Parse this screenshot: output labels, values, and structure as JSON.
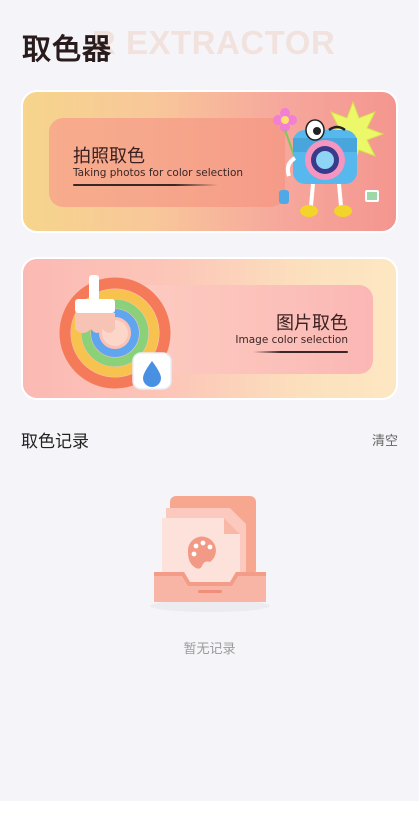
{
  "header": {
    "title": "取色器",
    "background_text": "R EXTRACTOR"
  },
  "cards": [
    {
      "title": "拍照取色",
      "subtitle": "Taking photos for color selection",
      "icon": "camera-character-icon"
    },
    {
      "title": "图片取色",
      "subtitle": "Image color selection",
      "icon": "rainbow-brush-icon"
    }
  ],
  "history": {
    "title": "取色记录",
    "clear_label": "清空",
    "empty_text": "暂无记录",
    "empty_icon": "empty-palette-tray-icon"
  },
  "colors": {
    "background": "#f5f5f9",
    "text_primary": "#222222",
    "text_muted": "#9a9a9a",
    "accent": "#f4968f"
  }
}
